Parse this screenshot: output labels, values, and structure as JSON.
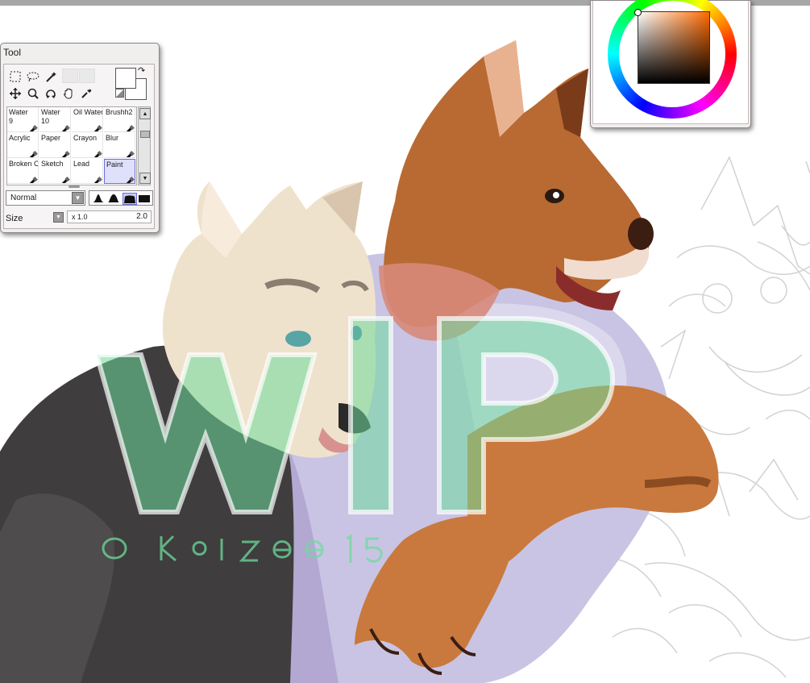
{
  "tool_panel": {
    "title": "Tool",
    "tools": [
      "rectangle-select-icon",
      "lasso-icon",
      "magic-wand-icon",
      "move-icon",
      "zoom-icon",
      "rotate-icon",
      "hand-icon",
      "eyedropper-icon"
    ],
    "brushes": [
      {
        "name": "Water",
        "size": "9"
      },
      {
        "name": "Water",
        "size": "10"
      },
      {
        "name": "Oil Water",
        "size": ""
      },
      {
        "name": "Brushh2",
        "size": ""
      },
      {
        "name": "Acrylic",
        "size": ""
      },
      {
        "name": "Paper",
        "size": ""
      },
      {
        "name": "Crayon",
        "size": ""
      },
      {
        "name": "Blur",
        "size": ""
      },
      {
        "name": "Broken C",
        "size": ""
      },
      {
        "name": "Sketch",
        "size": ""
      },
      {
        "name": "Lead",
        "size": ""
      },
      {
        "name": "Paint",
        "size": ""
      }
    ],
    "selected_brush": "Paint",
    "blend_mode": "Normal",
    "size_label": "Size",
    "size_multiplier": "x 1.0",
    "size_value": "2.0"
  },
  "color_panel": {
    "hue_color": "#ff6a00",
    "selected_color": "#ffffff"
  },
  "canvas": {
    "watermark_text": "WIP",
    "watermark_handle": "@kaizee15",
    "watermark_color": "#6ddb9c"
  }
}
